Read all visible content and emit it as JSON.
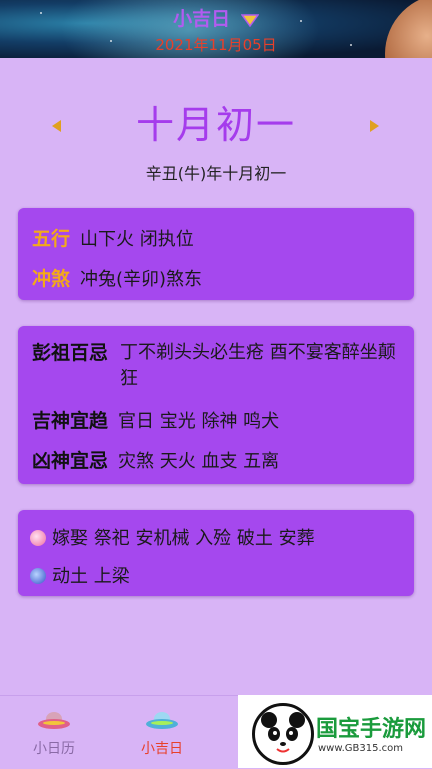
{
  "header": {
    "title": "小吉日",
    "date": "2021年11月05日"
  },
  "lunar": {
    "big": "十月初一",
    "full": "辛丑(牛)年十月初一"
  },
  "card1": {
    "rows": [
      {
        "label": "五行",
        "value": "山下火 闭执位"
      },
      {
        "label": "冲煞",
        "value": "冲兔(辛卯)煞东"
      }
    ]
  },
  "card2": {
    "rows": [
      {
        "label": "彭祖百忌",
        "value": "丁不剃头头必生疮 酉不宴客醉坐颠狂"
      },
      {
        "label": "吉神宜趋",
        "value": "官日 宝光 除神 鸣犬"
      },
      {
        "label": "凶神宜忌",
        "value": "灾煞 天火 血支 五离"
      }
    ]
  },
  "card3": {
    "good": "嫁娶 祭祀 安机械 入殓 破土 安葬",
    "bad": "动土 上梁"
  },
  "tabs": [
    {
      "label": "小日历",
      "color": "#8a6aa6"
    },
    {
      "label": "小吉日",
      "color": "#e8402a"
    }
  ],
  "ad": {
    "brand": "国宝手游网",
    "url": "www.GB315.com"
  },
  "colors": {
    "accent": "#a53cec",
    "card": "#a548ee",
    "gold": "#f3a91a"
  }
}
